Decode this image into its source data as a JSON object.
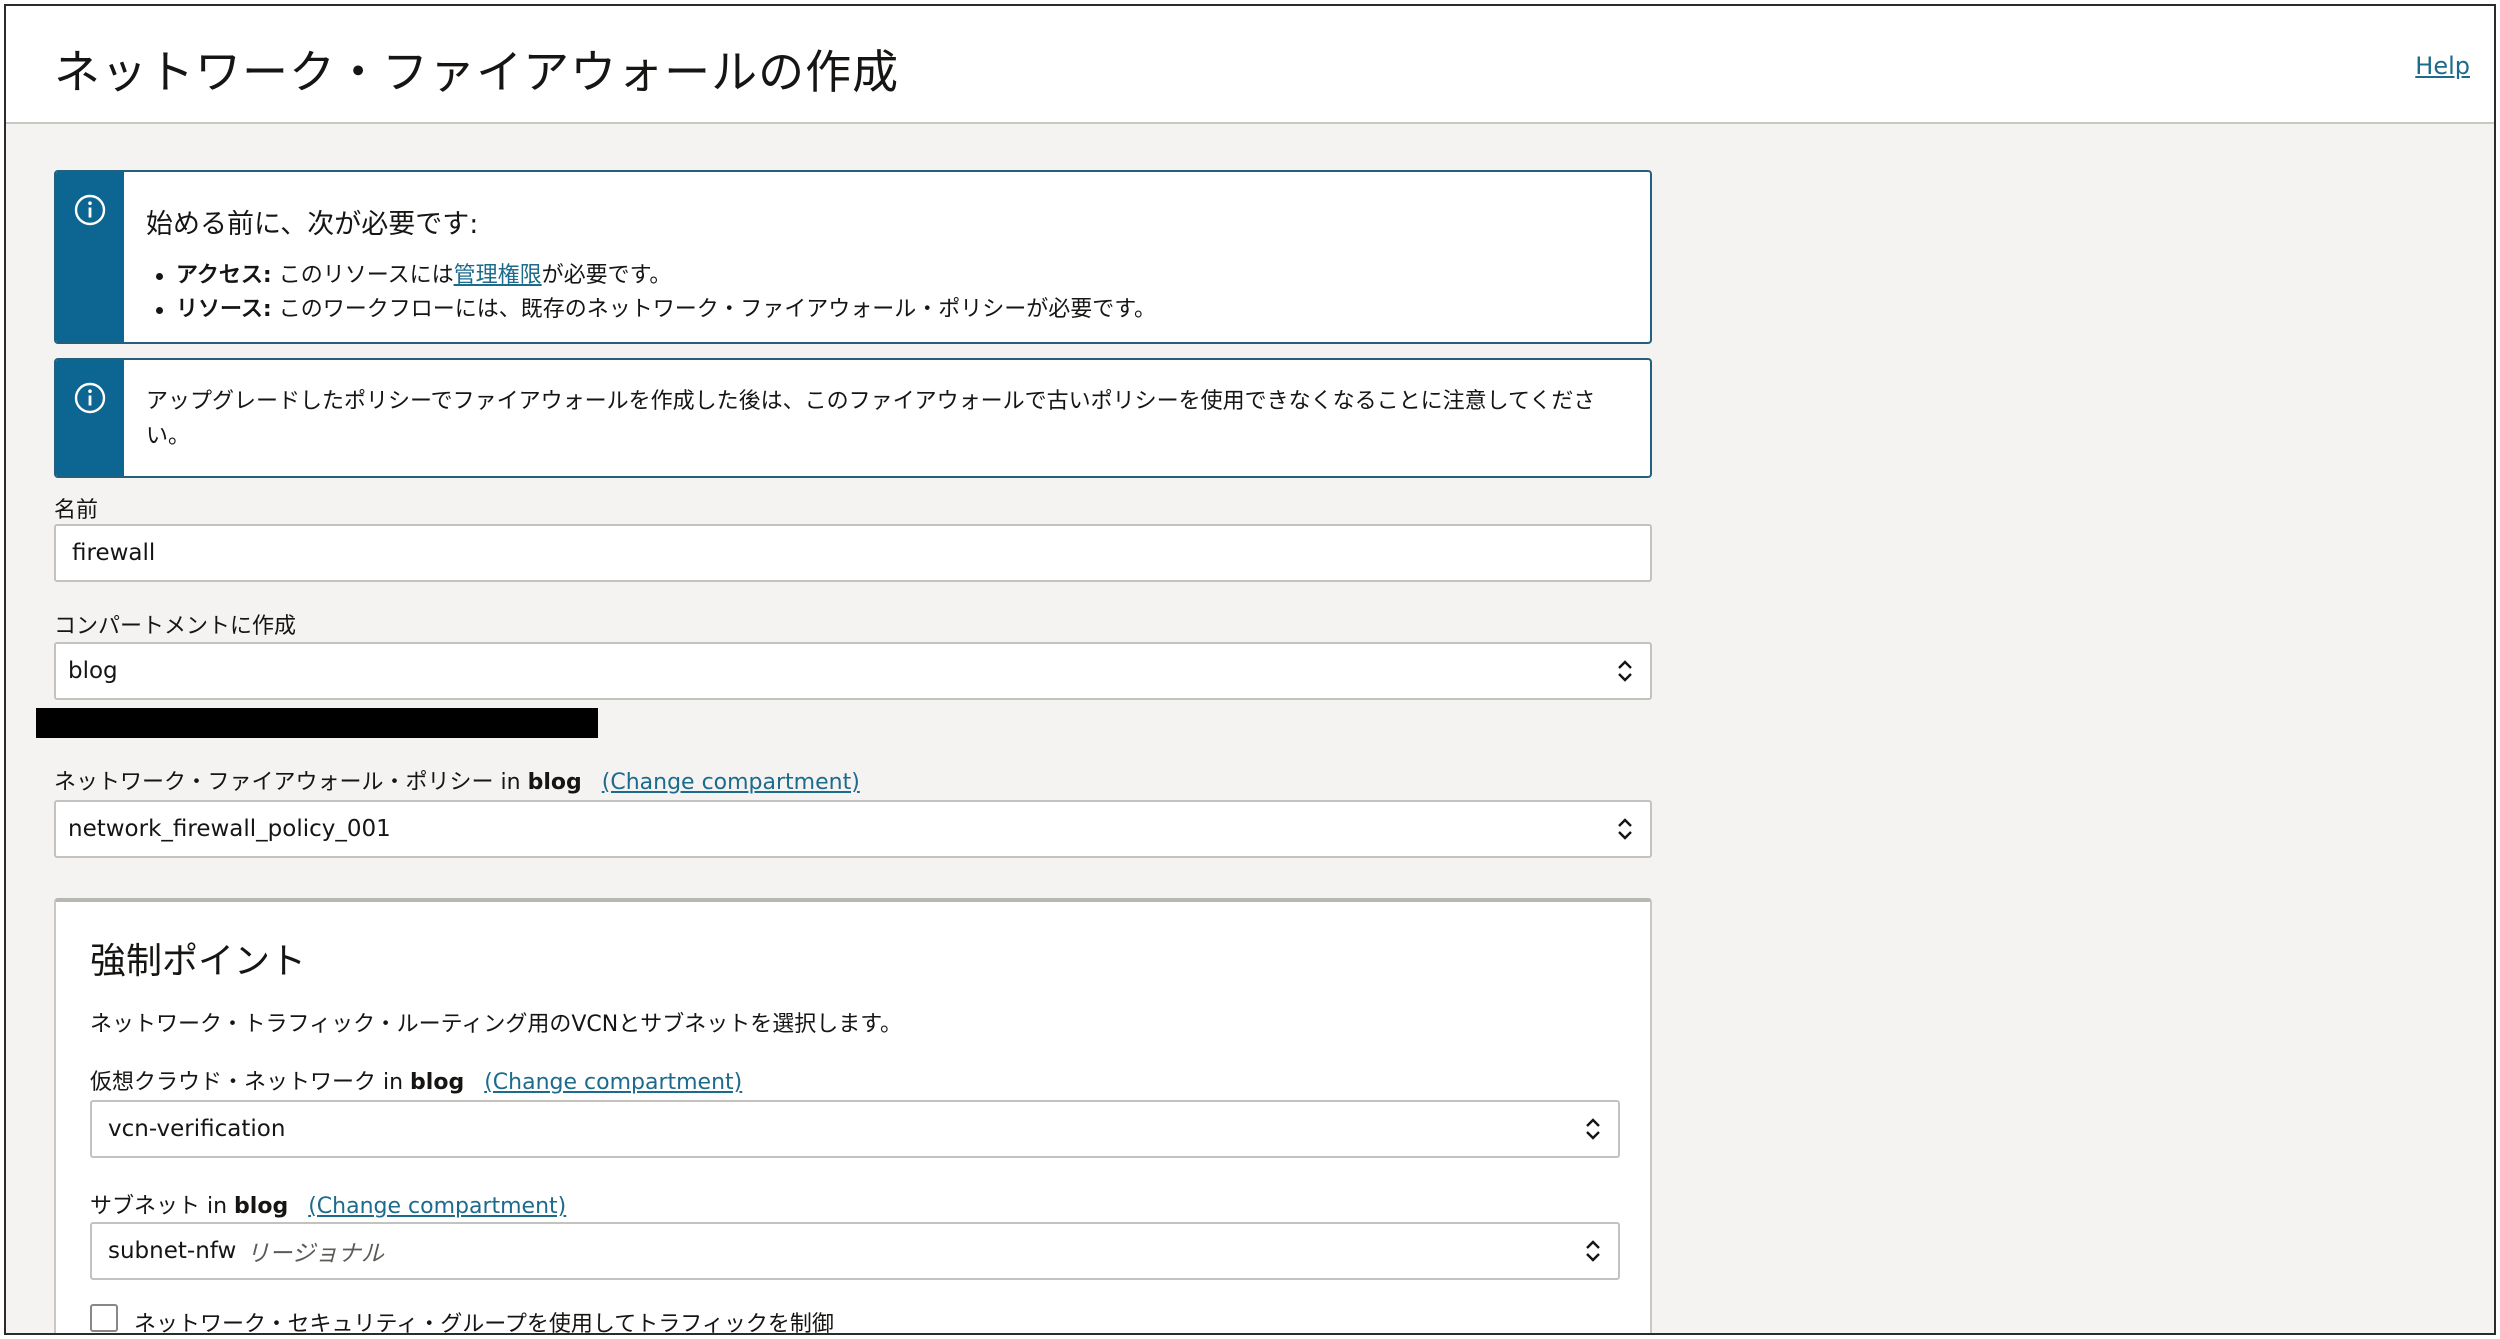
{
  "header": {
    "title": "ネットワーク・ファイアウォールの作成",
    "help_label": "Help"
  },
  "notice1": {
    "heading": "始める前に、次が必要です:",
    "items": [
      {
        "label": "アクセス:",
        "text_before": " このリソースには",
        "link": "管理権限",
        "text_after": "が必要です。"
      },
      {
        "label": "リソース:",
        "text_before": " このワークフローには、既存のネットワーク・ファイアウォール・ポリシーが必要です。",
        "link": "",
        "text_after": ""
      }
    ]
  },
  "notice2": {
    "text": "アップグレードしたポリシーでファイアウォールを作成した後は、このファイアウォールで古いポリシーを使用できなくなることに注意してください。"
  },
  "form": {
    "name_label": "名前",
    "name_value": "firewall",
    "compartment_label": "コンパートメントに作成",
    "compartment_value": "blog",
    "policy_label": "ネットワーク・ファイアウォール・ポリシー in ",
    "policy_compartment": "blog",
    "policy_change": "(Change compartment)",
    "policy_value": "network_firewall_policy_001"
  },
  "enforcement": {
    "title": "強制ポイント",
    "description": "ネットワーク・トラフィック・ルーティング用のVCNとサブネットを選択します。",
    "vcn_label": "仮想クラウド・ネットワーク in ",
    "vcn_compartment": "blog",
    "vcn_change": "(Change compartment)",
    "vcn_value": "vcn-verification",
    "subnet_label": "サブネット in ",
    "subnet_compartment": "blog",
    "subnet_change": "(Change compartment)",
    "subnet_value": "subnet-nfw",
    "subnet_tag": "リージョナル",
    "nsg_checkbox_label": "ネットワーク・セキュリティ・グループを使用してトラフィックを制御",
    "nsg_checked": false
  },
  "colors": {
    "accent": "#0d6591",
    "link": "#1c6b8c",
    "background": "#f4f3f1"
  }
}
